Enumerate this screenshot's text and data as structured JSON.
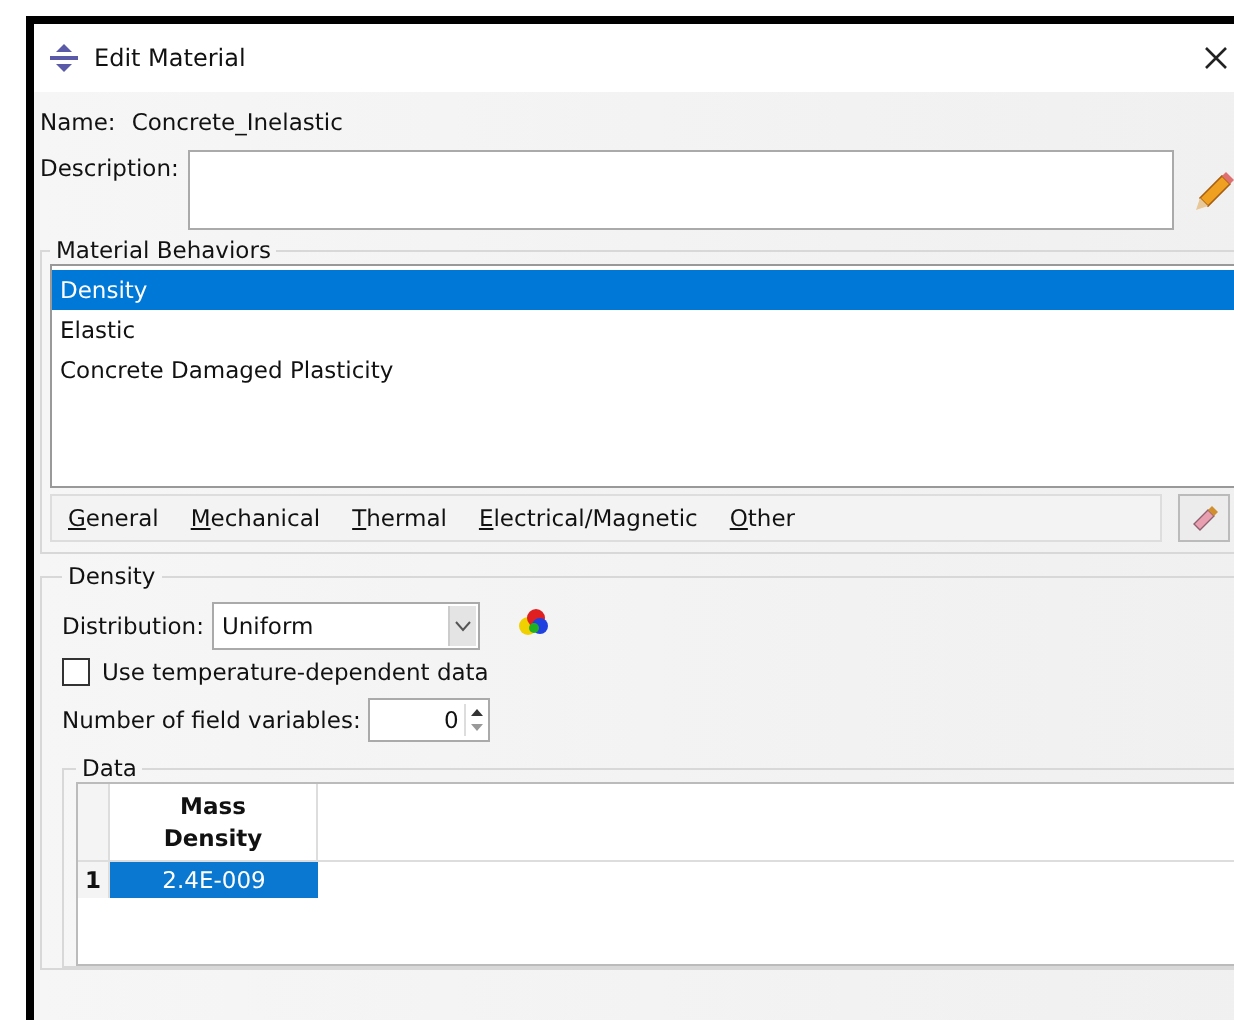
{
  "window": {
    "title": "Edit Material"
  },
  "name": {
    "label": "Name:",
    "value": "Concrete_Inelastic"
  },
  "description": {
    "label": "Description:"
  },
  "material_behaviors": {
    "title": "Material Behaviors",
    "items": [
      {
        "label": "Density",
        "selected": true
      },
      {
        "label": "Elastic",
        "selected": false
      },
      {
        "label": "Concrete Damaged Plasticity",
        "selected": false
      }
    ],
    "menus": [
      "General",
      "Mechanical",
      "Thermal",
      "Electrical/Magnetic",
      "Other"
    ]
  },
  "density": {
    "title": "Density",
    "distribution_label": "Distribution:",
    "distribution": "Uniform",
    "temperature_dependent": {
      "label": "Use temperature-dependent data",
      "checked": false
    },
    "field_variables_label": "Number of field variables:",
    "field_variables": "0",
    "data": {
      "title": "Data",
      "columns": [
        "Mass Density"
      ],
      "rows": [
        {
          "index": "1",
          "values": [
            "2.4E-009"
          ],
          "selected": true
        }
      ]
    }
  }
}
